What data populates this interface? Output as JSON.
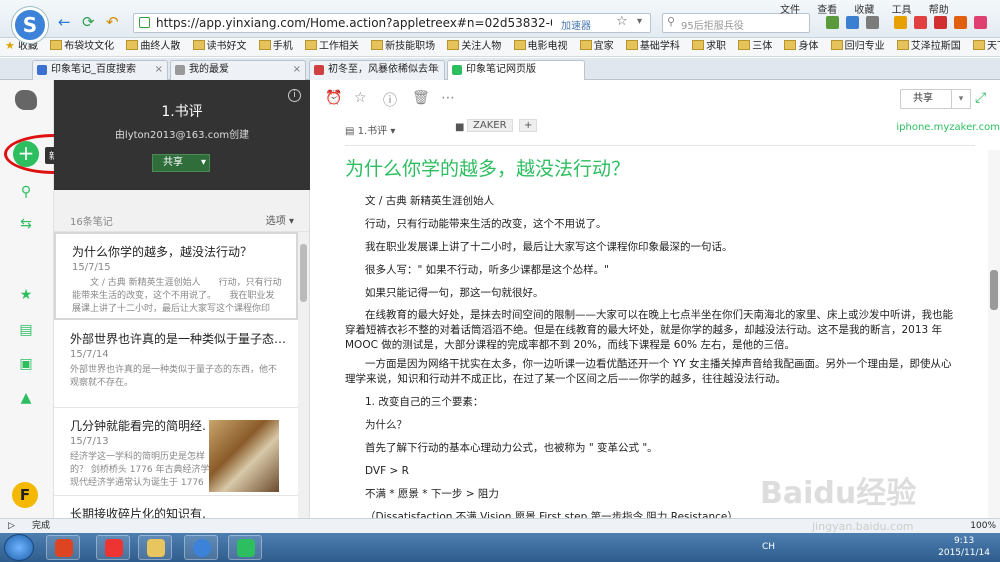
{
  "browser": {
    "url": "https://app.yinxiang.com/Home.action?appletreex#n=02d53832-0019-4138-8f57-f",
    "accelerator": "加速器",
    "search_placeholder": "95后拒服兵役",
    "menus": [
      "文件",
      "查看",
      "收藏",
      "工具",
      "帮助"
    ],
    "logo": "S"
  },
  "favorites": [
    "收藏",
    "布袋坟文化",
    "曲终人散",
    "读书好文",
    "手机",
    "工作相关",
    "新技能职场",
    "关注人物",
    "电影电视",
    "宜家",
    "基础学科",
    "求职",
    "三体",
    "身体",
    "回归专业",
    "艾泽拉斯国",
    "天下足球篮"
  ],
  "tabs": [
    {
      "label": "印象笔记_百度搜索",
      "active": false
    },
    {
      "label": "我的最爱",
      "active": false
    },
    {
      "label": "初冬至，风暴依稀似去年",
      "active": false
    },
    {
      "label": "印象笔记网页版",
      "active": true
    }
  ],
  "sidebar": {
    "new_note_tooltip": "新建笔记",
    "avatar": "F"
  },
  "notebook": {
    "title": "1.书评",
    "created_by": "由lyton2013@163.com创建",
    "share_label": "共享",
    "count_label": "16条笔记",
    "options_label": "选项"
  },
  "notes": [
    {
      "title": "为什么你学的越多，越没法行动？",
      "date": "15/7/15",
      "snippet": "　　文 / 古典 新精英生涯创始人　　行动，只有行动能带来生活的改变，这个不用说了。　　我在职业发展课上讲了十二小时，最后让大家写这个课程你印"
    },
    {
      "title": "外部世界也许真的是一种类似于量子态…",
      "date": "15/7/14",
      "snippet": "外部世界也许真的是一种类似于量子态的东西，他不观察就不存在。"
    },
    {
      "title": "几分钟就能看完的简明经…",
      "date": "15/7/13",
      "snippet": "经济学这一学科的简明历史是怎样的？ 剑桥桥头 1776 年古典经济学现代经济学通常认为诞生于 1776"
    },
    {
      "title": "长期接收碎片化的知识有…",
      "date": "",
      "snippet": ""
    }
  ],
  "editor": {
    "share_label": "共享",
    "notebook_label": "1.书评",
    "tag": "ZAKER",
    "tag_add": "+",
    "source": "iphone.myzaker.com",
    "title": "为什么你学的越多，越没法行动？",
    "paragraphs": [
      "文 / 古典 新精英生涯创始人",
      "行动，只有行动能带来生活的改变，这个不用说了。",
      "我在职业发展课上讲了十二小时，最后让大家写这个课程你印象最深的一句话。",
      "很多人写：\" 如果不行动，听多少课都是这个怂样。\"",
      "如果只能记得一句，那这一句就很好。",
      "在线教育的最大好处，是抹去时间空间的限制——大家可以在晚上七点半坐在你们天南海北的家里、床上或沙发中听讲，我也能穿着短裤衣衫不整的对着话筒滔滔不绝。但是在线教育的最大坏处，就是你学的越多，却越没法行动。这不是我的断言，2013 年 MOOC 做的测试是，大部分课程的完成率都不到 20%，而线下课程是 60% 左右，是他的三倍。",
      "一方面是因为网络干扰实在太多，你一边听课一边看优酷还开一个 YY 女主播关掉声音给我配画面。另外一个理由是，即使从心理学来说，知识和行动并不成正比，在过了某一个区间之后——你学的越多，往往越没法行动。",
      "1. 改变自己的三个要素：",
      "为什么？",
      "首先了解下行动的基本心理动力公式，也被称为 \" 变革公式 \"。",
      "DVF > R",
      "不满 * 愿景 * 下一步 > 阻力",
      "（Dissatisfaction 不满 Vision 愿景 First step 第一步指令 阻力 Resistance）"
    ]
  },
  "status": {
    "text": "完成",
    "zoom": "100%"
  },
  "taskbar": {
    "time": "9:13",
    "date": "2015/11/14",
    "lang": "CH"
  },
  "watermark": {
    "brand": "Baidu经验",
    "url": "jingyan.baidu.com"
  },
  "colors": {
    "accent": "#2dbe60",
    "highlight": "#d11111"
  }
}
